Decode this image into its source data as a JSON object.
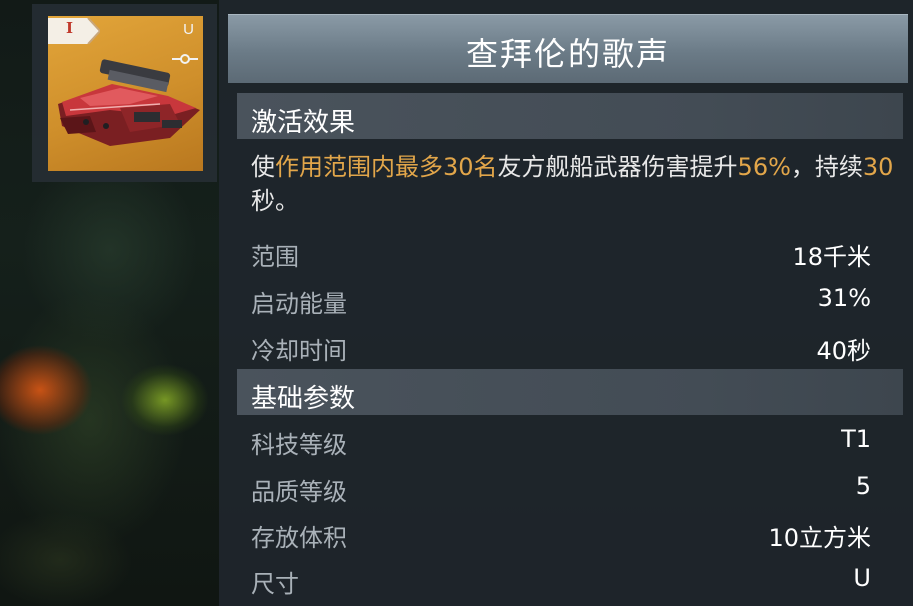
{
  "item": {
    "tier": "I",
    "size_letter": "U",
    "slot_icon": "slot-connector-icon",
    "thumb_color": "#d59a33"
  },
  "title": "查拜伦的歌声",
  "activation": {
    "header": "激活效果",
    "desc_parts": [
      {
        "text": "使",
        "hl": false
      },
      {
        "text": "作用范围内最多30名",
        "hl": true
      },
      {
        "text": "友方舰船武器伤害提升",
        "hl": false
      },
      {
        "text": "56%",
        "hl": true
      },
      {
        "text": "，持续",
        "hl": false
      },
      {
        "text": "30",
        "hl": true
      },
      {
        "text": "秒。",
        "hl": false
      }
    ],
    "rows": [
      {
        "label": "范围",
        "value": "18千米"
      },
      {
        "label": "启动能量",
        "value": "31%"
      },
      {
        "label": "冷却时间",
        "value": "40秒"
      }
    ]
  },
  "basic": {
    "header": "基础参数",
    "rows": [
      {
        "label": "科技等级",
        "value": "T1"
      },
      {
        "label": "品质等级",
        "value": "5"
      },
      {
        "label": "存放体积",
        "value": "10立方米"
      },
      {
        "label": "尺寸",
        "value": "U"
      }
    ]
  },
  "colors": {
    "highlight": "#e2a64a",
    "panel": "#20262d",
    "title_bar": "#6b7b87"
  }
}
